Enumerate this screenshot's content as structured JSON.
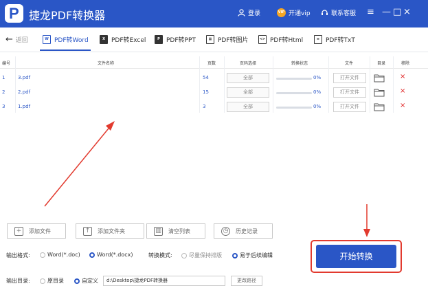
{
  "app": {
    "logo_letter": "P",
    "title": "捷龙PDF转换器",
    "accent_color": "#2a56c6",
    "login_label": "登录",
    "vip_badge": "VIP",
    "vip_label": "开通vip",
    "service_label": "联系客服",
    "menu_icon": "≡",
    "minimize_icon": "—",
    "restore_icon": "□",
    "close_icon": "×"
  },
  "nav": {
    "back_label": "返回",
    "tabs": [
      {
        "label": "PDF转Word",
        "icon": "W"
      },
      {
        "label": "PDF转Excel",
        "icon": "X"
      },
      {
        "label": "PDF转PPT",
        "icon": "P"
      },
      {
        "label": "PDF转图片",
        "icon": "▦"
      },
      {
        "label": "PDF转Html",
        "icon": "<>"
      },
      {
        "label": "PDF转TxT",
        "icon": "≡"
      }
    ]
  },
  "table": {
    "headers": [
      "编号",
      "文件名称",
      "页数",
      "页码选择",
      "转换状态",
      "文件",
      "目录",
      "移除"
    ],
    "rows": [
      {
        "index": "1",
        "name": "3.pdf",
        "pages": "54",
        "range": "全部",
        "progress": "0%",
        "open": "打开文件"
      },
      {
        "index": "2",
        "name": "2.pdf",
        "pages": "15",
        "range": "全部",
        "progress": "0%",
        "open": "打开文件"
      },
      {
        "index": "3",
        "name": "1.pdf",
        "pages": "3",
        "range": "全部",
        "progress": "0%",
        "open": "打开文件"
      }
    ],
    "remove_icon": "×"
  },
  "actions": {
    "add_file": "添加文件",
    "add_folder": "添加文件夹",
    "clear_list": "清空列表",
    "history": "历史记录"
  },
  "options": {
    "format_label": "输出格式:",
    "format_doc": "Word(*.doc)",
    "format_docx": "Word(*.docx)",
    "mode_label": "转换模式:",
    "mode_layout": "尽量保持排版",
    "mode_edit": "易于后续编辑",
    "dir_label": "输出目录:",
    "dir_original": "原目录",
    "dir_custom": "自定义",
    "path_value": "d:\\Desktop\\捷龙PDF转换器",
    "change_path": "更改路径"
  },
  "start_button": "开始转换",
  "highlight_color": "#e23a2e"
}
